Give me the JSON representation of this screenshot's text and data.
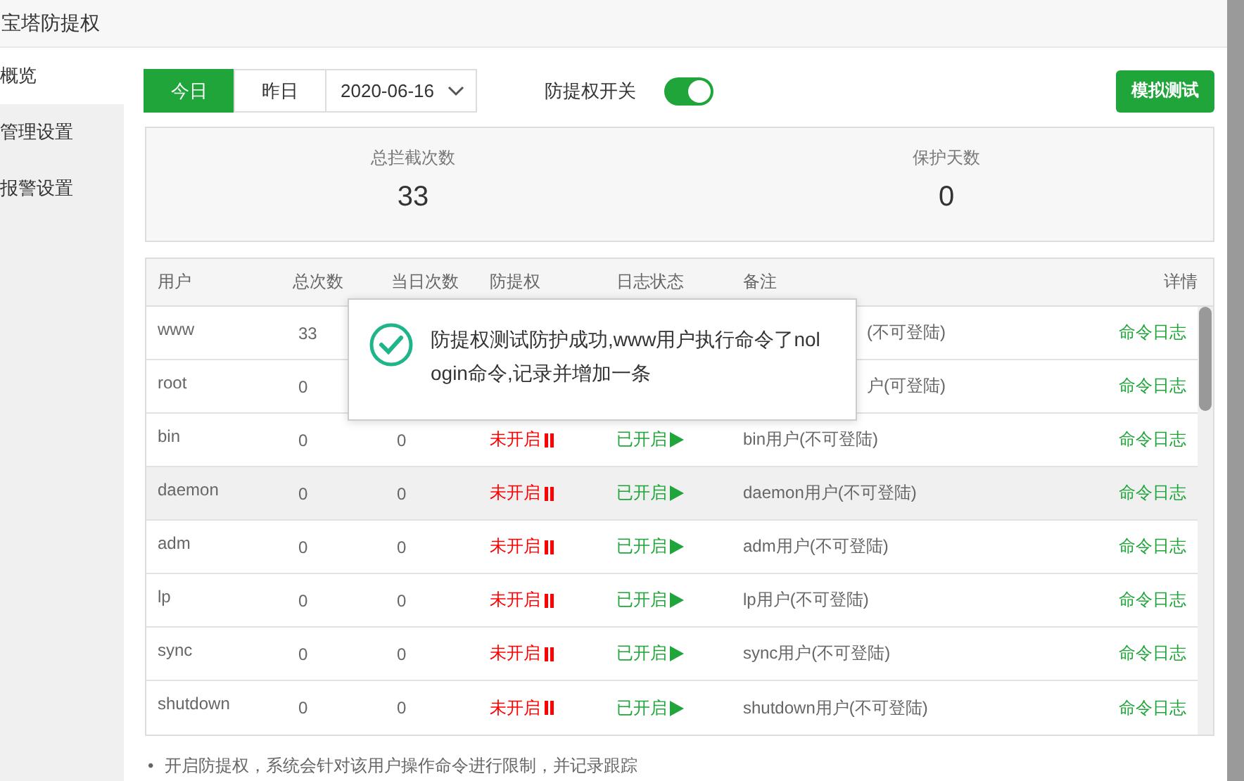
{
  "window": {
    "title": "宝塔防提权"
  },
  "sidebar": {
    "items": [
      {
        "label": "概览",
        "selected": true
      },
      {
        "label": "管理设置",
        "selected": false
      },
      {
        "label": "报警设置",
        "selected": false
      }
    ]
  },
  "toolbar": {
    "day_tabs": [
      {
        "label": "今日",
        "selected": true
      },
      {
        "label": "昨日",
        "selected": false
      }
    ],
    "date": "2020-06-16",
    "switch_label": "防提权开关",
    "switch_on": true,
    "test_button": "模拟测试"
  },
  "stats": [
    {
      "label": "总拦截次数",
      "value": "33"
    },
    {
      "label": "保护天数",
      "value": "0"
    }
  ],
  "table": {
    "columns": [
      "用户",
      "总次数",
      "当日次数",
      "防提权",
      "日志状态",
      "备注",
      "详情"
    ],
    "rows": [
      {
        "user": "www",
        "total": "33",
        "remark": "(不可登陆)",
        "detail": "命令日志",
        "hover": false
      },
      {
        "user": "root",
        "total": "0",
        "remark": "户(可登陆)",
        "detail": "命令日志",
        "hover": false
      },
      {
        "user": "bin",
        "total": "0",
        "today": "0",
        "protect": "未开启",
        "protect_on": false,
        "log": "已开启",
        "log_on": true,
        "remark": "bin用户(不可登陆)",
        "detail": "命令日志",
        "hover": false
      },
      {
        "user": "daemon",
        "total": "0",
        "today": "0",
        "protect": "未开启",
        "protect_on": false,
        "log": "已开启",
        "log_on": true,
        "remark": "daemon用户(不可登陆)",
        "detail": "命令日志",
        "hover": true
      },
      {
        "user": "adm",
        "total": "0",
        "today": "0",
        "protect": "未开启",
        "protect_on": false,
        "log": "已开启",
        "log_on": true,
        "remark": "adm用户(不可登陆)",
        "detail": "命令日志",
        "hover": false
      },
      {
        "user": "lp",
        "total": "0",
        "today": "0",
        "protect": "未开启",
        "protect_on": false,
        "log": "已开启",
        "log_on": true,
        "remark": "lp用户(不可登陆)",
        "detail": "命令日志",
        "hover": false
      },
      {
        "user": "sync",
        "total": "0",
        "today": "0",
        "protect": "未开启",
        "protect_on": false,
        "log": "已开启",
        "log_on": true,
        "remark": "sync用户(不可登陆)",
        "detail": "命令日志",
        "hover": false
      },
      {
        "user": "shutdown",
        "total": "0",
        "today": "0",
        "protect": "未开启",
        "protect_on": false,
        "log": "已开启",
        "log_on": true,
        "remark": "shutdown用户(不可登陆)",
        "detail": "命令日志",
        "hover": false
      }
    ]
  },
  "toast": {
    "message": "防提权测试防护成功,www用户执行命令了nologin命令,记录并增加一条"
  },
  "notes": [
    {
      "bullet": "•",
      "text": "开启防提权，系统会针对该用户操作命令进行限制，并记录跟踪"
    }
  ]
}
